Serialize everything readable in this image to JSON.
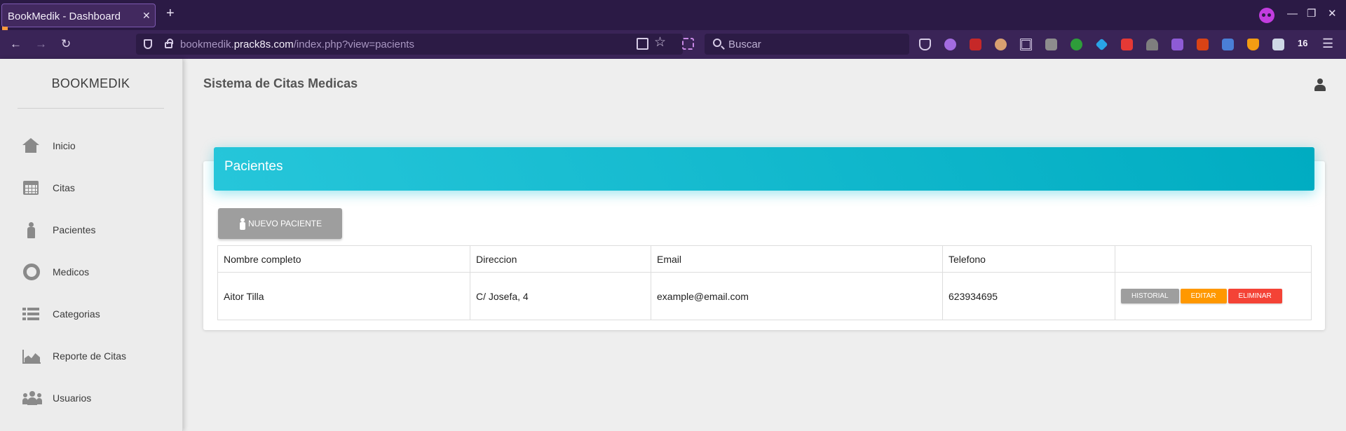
{
  "browser": {
    "tab_title": "BookMedik - Dashboard",
    "url_host_prefix": "bookmedik.",
    "url_host_main": "prack8s.com",
    "url_path": "/index.php?view=pacients",
    "search_placeholder": "Buscar",
    "extension_count": "16",
    "extensions": [
      "pocket-icon",
      "extension-purple-icon",
      "extension-red-badge-icon",
      "extension-face-icon",
      "qr-code-icon",
      "extension-s-icon",
      "extension-green-icon",
      "extension-diamond-icon",
      "camera-icon",
      "extension-puzzle-icon",
      "extension-cube-icon",
      "hd-icon",
      "translate-icon",
      "extension-badge-icon",
      "extension-copy-icon"
    ]
  },
  "sidebar": {
    "brand": "BOOKMEDIK",
    "items": [
      {
        "label": "Inicio",
        "icon": "home-icon"
      },
      {
        "label": "Citas",
        "icon": "calendar-icon"
      },
      {
        "label": "Pacientes",
        "icon": "person-icon"
      },
      {
        "label": "Medicos",
        "icon": "life-ring-icon"
      },
      {
        "label": "Categorias",
        "icon": "list-icon"
      },
      {
        "label": "Reporte de Citas",
        "icon": "area-chart-icon"
      },
      {
        "label": "Usuarios",
        "icon": "users-icon"
      }
    ]
  },
  "header": {
    "title": "Sistema de Citas Medicas"
  },
  "card": {
    "title": "Pacientes",
    "new_button": "NUEVO PACIENTE",
    "columns": [
      "Nombre completo",
      "Direccion",
      "Email",
      "Telefono",
      ""
    ],
    "rows": [
      {
        "name": "Aitor Tilla",
        "address": "C/ Josefa, 4",
        "email": "example@email.com",
        "phone": "623934695"
      }
    ],
    "actions": {
      "history": "HISTORIAL",
      "edit": "EDITAR",
      "delete": "ELIMINAR"
    }
  },
  "colors": {
    "accent_cyan": "#00acc1",
    "btn_grey": "#9e9e9e",
    "btn_orange": "#ff9800",
    "btn_red": "#f44336",
    "browser_bg": "#2b1a45"
  }
}
